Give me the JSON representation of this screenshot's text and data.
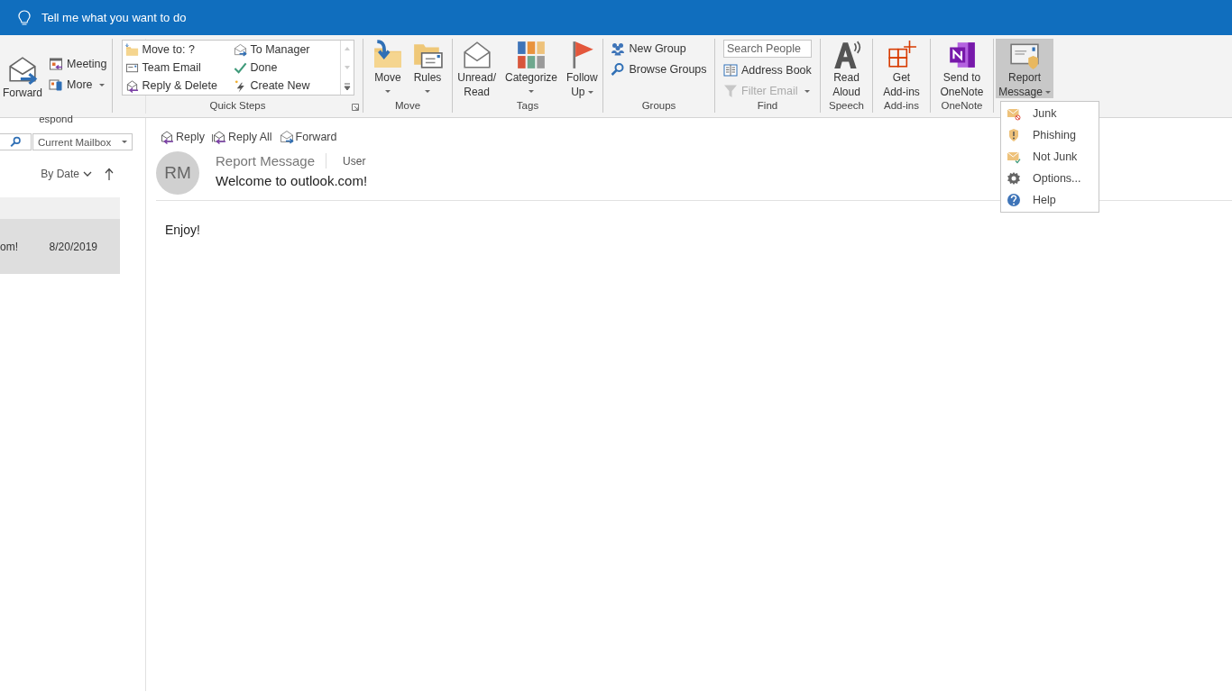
{
  "tell_me": {
    "placeholder": "Tell me what you want to do"
  },
  "ribbon": {
    "groups": [
      {
        "label": "espond",
        "launcher": false,
        "items": [
          {
            "kind": "large",
            "lines": [
              "Forward"
            ],
            "dropdown": false,
            "pressed": false
          },
          {
            "kind": "small",
            "label": "Meeting",
            "dropdown": false,
            "disabled": false
          },
          {
            "kind": "small",
            "label": "More",
            "dropdown": true,
            "disabled": false
          }
        ]
      },
      {
        "label": "Quick Steps",
        "launcher": true,
        "items": [
          {
            "kind": "gallery",
            "entries": [
              "Move to: ?",
              "To Manager",
              "Team Email",
              "Done",
              "Reply & Delete",
              "Create New"
            ]
          }
        ]
      },
      {
        "label": "Move",
        "launcher": false,
        "items": [
          {
            "kind": "large",
            "lines": [
              "Move"
            ],
            "dropdown": true,
            "pressed": false
          },
          {
            "kind": "large",
            "lines": [
              "Rules"
            ],
            "dropdown": true,
            "pressed": false
          }
        ]
      },
      {
        "label": "Tags",
        "launcher": false,
        "items": [
          {
            "kind": "large",
            "lines": [
              "Unread/",
              "Read"
            ],
            "dropdown": false,
            "pressed": false
          },
          {
            "kind": "large",
            "lines": [
              "Categorize"
            ],
            "dropdown": true,
            "pressed": false
          },
          {
            "kind": "large",
            "lines": [
              "Follow",
              "Up"
            ],
            "dropdown": true,
            "pressed": false
          }
        ]
      },
      {
        "label": "Groups",
        "launcher": false,
        "items": [
          {
            "kind": "small",
            "label": "New Group",
            "dropdown": false,
            "disabled": false
          },
          {
            "kind": "small",
            "label": "Browse Groups",
            "dropdown": false,
            "disabled": false
          }
        ]
      },
      {
        "label": "Find",
        "launcher": false,
        "items": [
          {
            "kind": "search",
            "placeholder": "Search People"
          },
          {
            "kind": "small",
            "label": "Address Book",
            "dropdown": false,
            "disabled": false
          },
          {
            "kind": "small",
            "label": "Filter Email",
            "dropdown": true,
            "disabled": true
          }
        ]
      },
      {
        "label": "Speech",
        "launcher": false,
        "items": [
          {
            "kind": "large",
            "lines": [
              "Read",
              "Aloud"
            ],
            "dropdown": false,
            "pressed": false
          }
        ]
      },
      {
        "label": "Add-ins",
        "launcher": false,
        "items": [
          {
            "kind": "large",
            "lines": [
              "Get",
              "Add-ins"
            ],
            "dropdown": false,
            "pressed": false
          }
        ]
      },
      {
        "label": "OneNote",
        "launcher": false,
        "items": [
          {
            "kind": "large",
            "lines": [
              "Send to",
              "OneNote"
            ],
            "dropdown": false,
            "pressed": false
          }
        ]
      },
      {
        "items": [
          {
            "kind": "large",
            "lines": [
              "Report",
              "Message"
            ],
            "dropdown": true,
            "pressed": true
          }
        ]
      }
    ]
  },
  "report_menu": {
    "items": [
      "Junk",
      "Phishing",
      "Not Junk",
      "Options...",
      "Help"
    ]
  },
  "message_list": {
    "scope": "Current Mailbox",
    "sort": "By Date",
    "rows": [
      {
        "subject": "om!",
        "date": "8/20/2019",
        "selected": true
      }
    ]
  },
  "reading_pane": {
    "actions": [
      "Reply",
      "Reply All",
      "Forward"
    ],
    "initials": "RM",
    "sender": "Report Message",
    "recipient": "User",
    "subject": "Welcome to outlook.com!",
    "body": "Enjoy!"
  }
}
